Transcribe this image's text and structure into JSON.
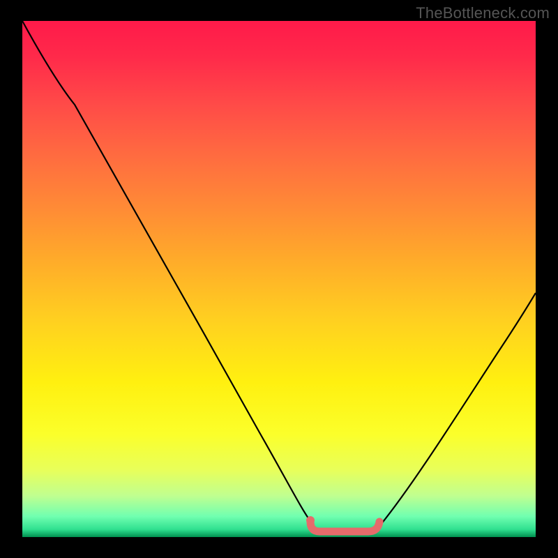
{
  "watermark": "TheBottleneck.com",
  "colors": {
    "background": "#000000",
    "curve_stroke": "#000000",
    "flat_region": "#e56b6b",
    "watermark_text": "#555555"
  },
  "chart_data": {
    "type": "line",
    "title": "",
    "xlabel": "",
    "ylabel": "",
    "xlim": [
      0,
      100
    ],
    "ylim": [
      0,
      100
    ],
    "series": [
      {
        "name": "bottleneck-curve",
        "x": [
          0,
          5,
          10,
          15,
          20,
          25,
          30,
          35,
          40,
          45,
          50,
          52,
          55,
          58,
          62,
          66,
          68,
          72,
          78,
          85,
          92,
          100
        ],
        "y": [
          100,
          94,
          87,
          80,
          72,
          64,
          55,
          46,
          37,
          27,
          16,
          11,
          5,
          2,
          1,
          1,
          2,
          5,
          12,
          22,
          33,
          46
        ]
      }
    ],
    "annotations": [
      {
        "name": "optimal-flat-region",
        "x_range": [
          55,
          68
        ],
        "y": 1,
        "color": "#e56b6b"
      }
    ],
    "background_gradient": {
      "direction": "vertical",
      "stops": [
        {
          "pos": 0.0,
          "color": "#ff1a4a"
        },
        {
          "pos": 0.16,
          "color": "#ff4a48"
        },
        {
          "pos": 0.36,
          "color": "#ff8a36"
        },
        {
          "pos": 0.58,
          "color": "#ffd020"
        },
        {
          "pos": 0.8,
          "color": "#fbff2a"
        },
        {
          "pos": 0.92,
          "color": "#c0ff90"
        },
        {
          "pos": 1.0,
          "color": "#009050"
        }
      ]
    }
  }
}
